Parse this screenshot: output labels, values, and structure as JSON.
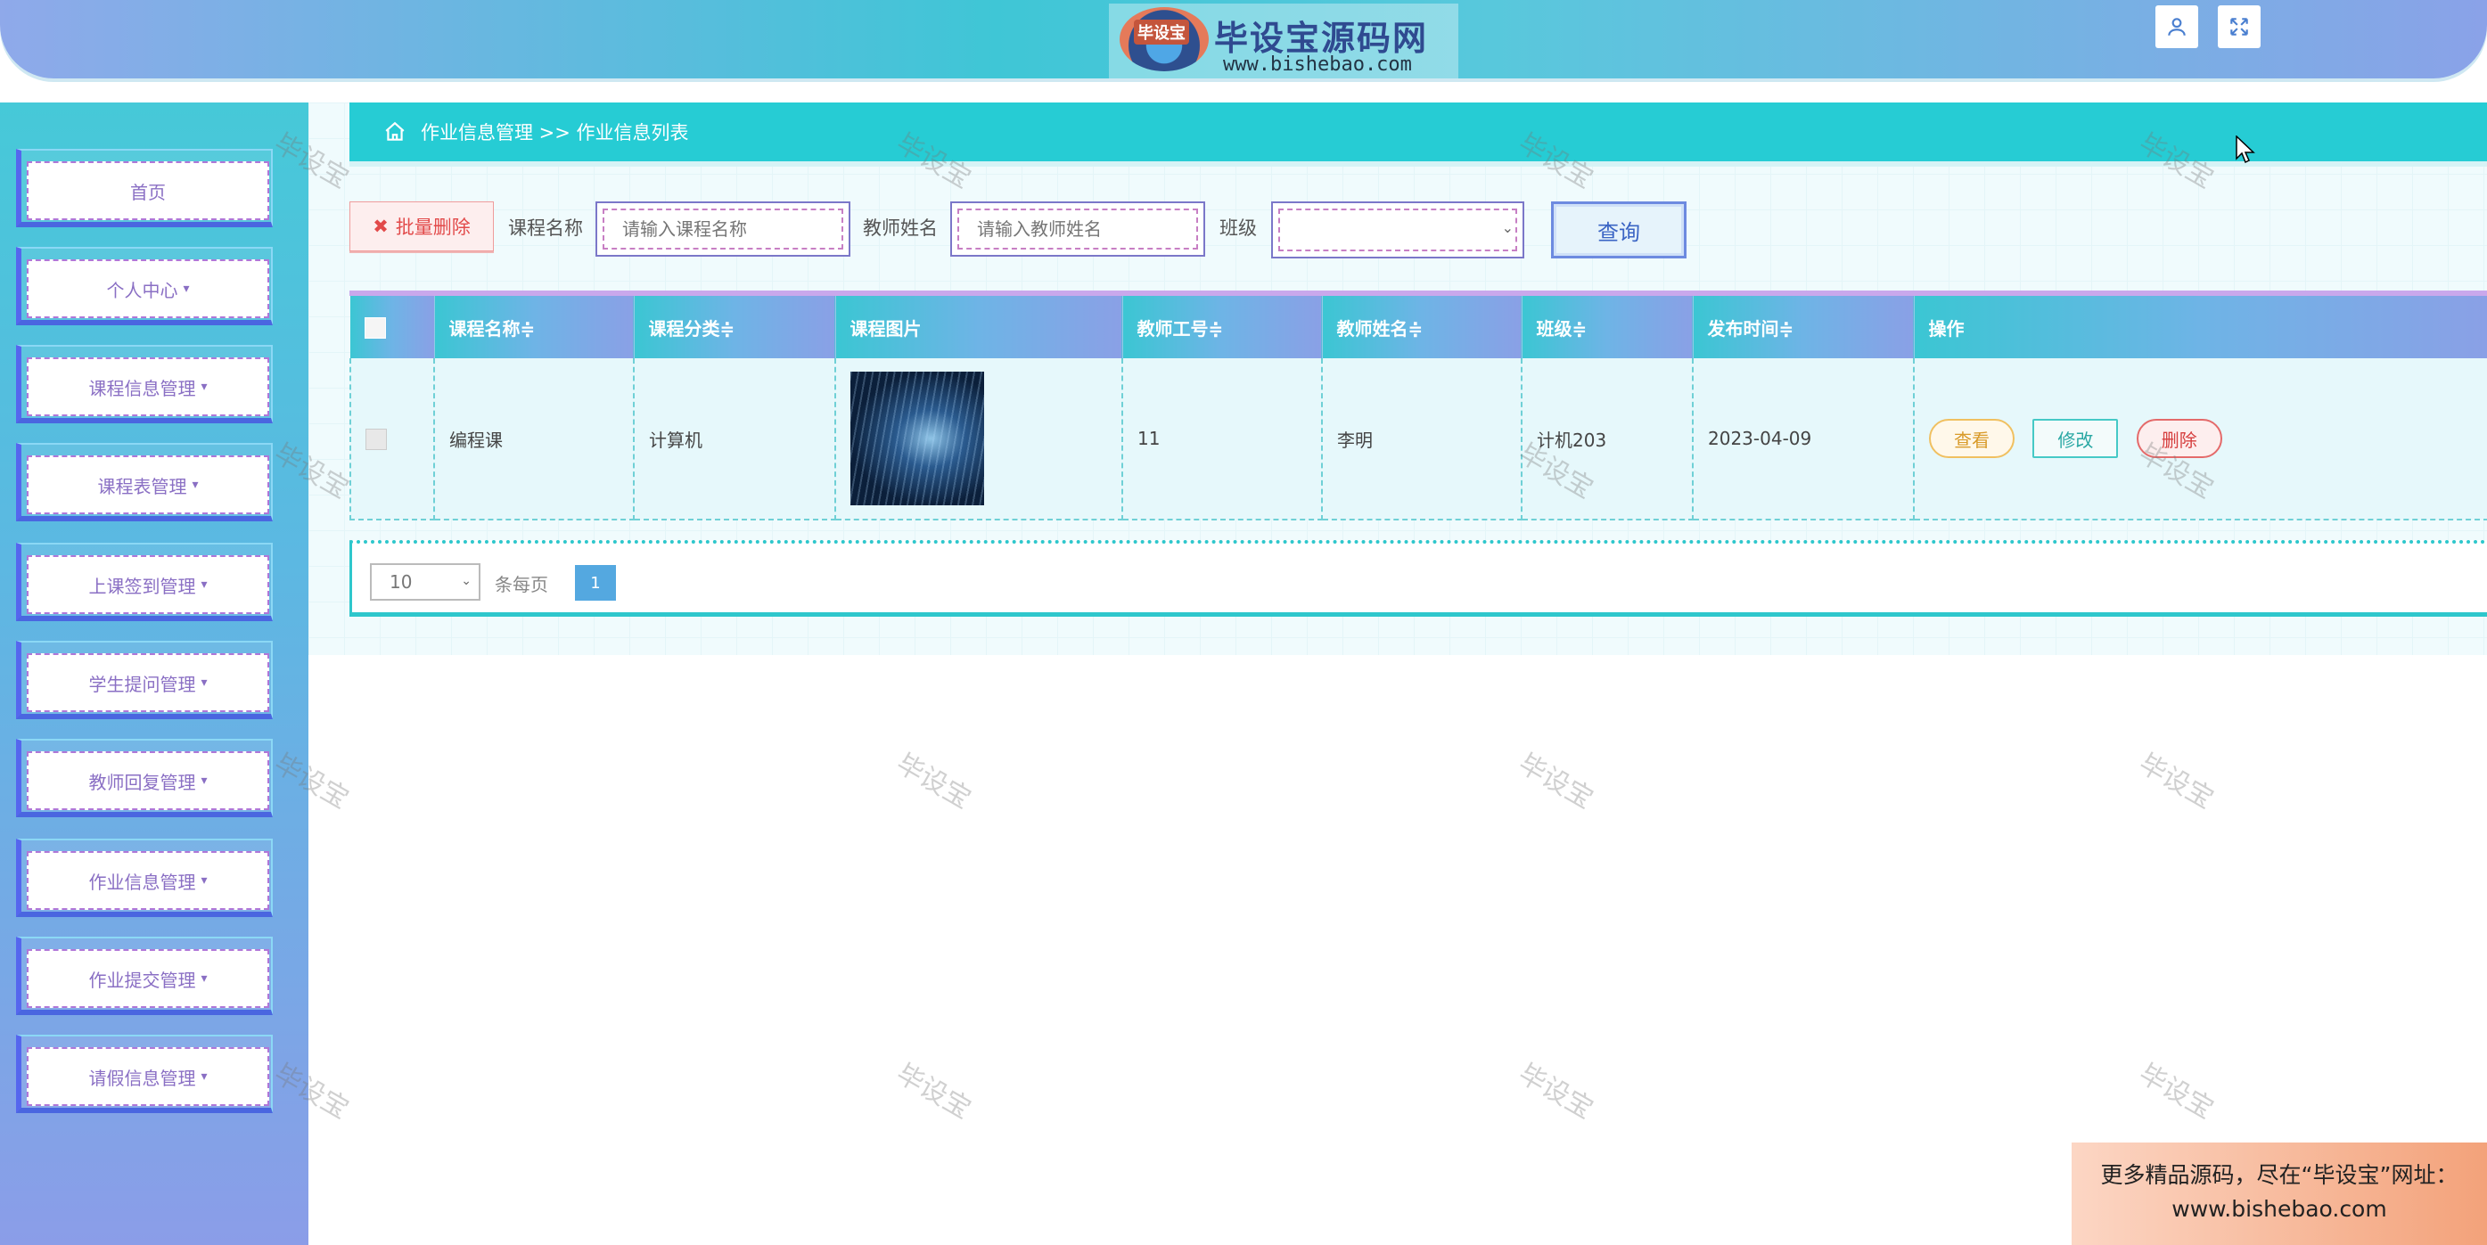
{
  "header": {
    "logo_badge": "毕设宝",
    "logo_title": "毕设宝源码网",
    "logo_url": "www.bishebao.com",
    "user_icon": "user-icon",
    "fullscreen_icon": "expand-icon"
  },
  "sidebar": {
    "items": [
      {
        "label": "首页",
        "has_caret": false
      },
      {
        "label": "个人中心",
        "has_caret": true
      },
      {
        "label": "课程信息管理",
        "has_caret": true
      },
      {
        "label": "课程表管理",
        "has_caret": true
      },
      {
        "label": "上课签到管理",
        "has_caret": true
      },
      {
        "label": "学生提问管理",
        "has_caret": true
      },
      {
        "label": "教师回复管理",
        "has_caret": true
      },
      {
        "label": "作业信息管理",
        "has_caret": true
      },
      {
        "label": "作业提交管理",
        "has_caret": true
      },
      {
        "label": "请假信息管理",
        "has_caret": true
      }
    ]
  },
  "breadcrumb": {
    "text": "作业信息管理 >> 作业信息列表"
  },
  "search": {
    "batch_delete_label": "批量删除",
    "course_label": "课程名称",
    "course_placeholder": "请输入课程名称",
    "teacher_label": "教师姓名",
    "teacher_placeholder": "请输入教师姓名",
    "class_label": "班级",
    "query_label": "查询"
  },
  "table": {
    "headers": [
      "课程名称≑",
      "课程分类≑",
      "课程图片",
      "教师工号≑",
      "教师姓名≑",
      "班级≑",
      "发布时间≑",
      "操作"
    ],
    "rows": [
      {
        "course_name": "编程课",
        "category": "计算机",
        "teacher_id": "11",
        "teacher_name": "李明",
        "class": "计机203",
        "publish_time": "2023-04-09",
        "actions": {
          "view": "查看",
          "edit": "修改",
          "delete": "删除"
        }
      }
    ]
  },
  "pager": {
    "page_size": "10",
    "page_size_label": "条每页",
    "current_page": "1"
  },
  "watermark": "毕设宝",
  "ad": {
    "line1": "更多精品源码，尽在“毕设宝”网址：",
    "line2": "www.bishebao.com"
  },
  "colors": {
    "header_accent": "#3fc6d6",
    "breadcrumb_bg": "#26ccd4",
    "delete_red": "#e24a4a",
    "query_blue": "#3a64c4"
  }
}
